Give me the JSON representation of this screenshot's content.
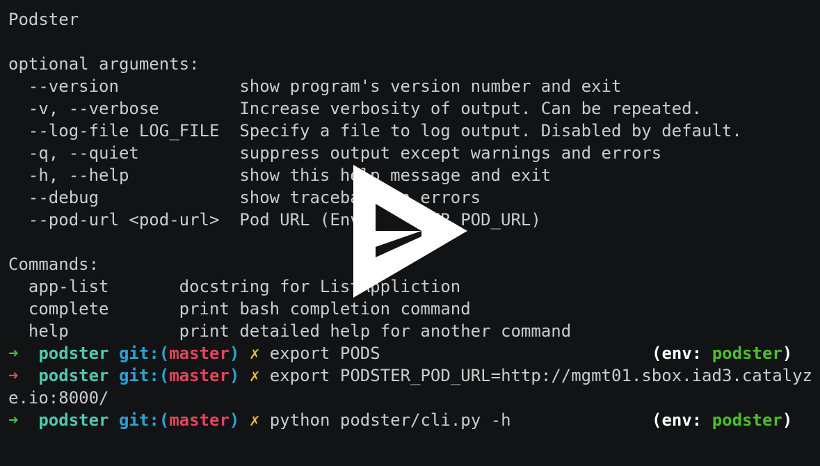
{
  "colors": {
    "background": "#121314",
    "text": "#cccccc",
    "arrow_ok": "#3fbf3f",
    "arrow_err": "#e0475a",
    "dir": "#4fc9b0",
    "git": "#2aa3d6",
    "branch": "#e0475a",
    "dirty": "#e5b93a",
    "env_value": "#4bbf2a",
    "env_label": "#ffffff",
    "play": "#ffffff"
  },
  "help_output": {
    "app_name": "Podster",
    "optional_header": "optional arguments:",
    "options": [
      {
        "flag": "--version",
        "desc": "show program's version number and exit"
      },
      {
        "flag": "-v, --verbose",
        "desc": "Increase verbosity of output. Can be repeated."
      },
      {
        "flag": "--log-file LOG_FILE",
        "desc": "Specify a file to log output. Disabled by default."
      },
      {
        "flag": "-q, --quiet",
        "desc": "suppress output except warnings and errors"
      },
      {
        "flag": "-h, --help",
        "desc": "show this help message and exit"
      },
      {
        "flag": "--debug",
        "desc": "show traceback on errors"
      },
      {
        "flag": "--pod-url <pod-url>",
        "desc": "Pod URL (Env: PODSTER_POD_URL)"
      }
    ],
    "commands_header": "Commands:",
    "commands": [
      {
        "name": "app-list",
        "desc": "docstring for ListAppliction"
      },
      {
        "name": "complete",
        "desc": "print bash completion command"
      },
      {
        "name": "help",
        "desc": "print detailed help for another command"
      }
    ]
  },
  "prompts": [
    {
      "arrow": "➜",
      "status": "ok",
      "dir": "podster",
      "git_label": "git:(",
      "branch": "master",
      "git_close": ")",
      "dirty_mark": "✗",
      "command": "export PODS",
      "continuation": "",
      "env_open": "(env: ",
      "env_name": "podster",
      "env_close": ")"
    },
    {
      "arrow": "➜",
      "status": "err",
      "dir": "podster",
      "git_label": "git:(",
      "branch": "master",
      "git_close": ")",
      "dirty_mark": "✗",
      "command": "export PODSTER_POD_URL=http://mgmt01.sbox.iad3.catalyz",
      "continuation": "e.io:8000/",
      "env_open": "",
      "env_name": "",
      "env_close": ""
    },
    {
      "arrow": "➜",
      "status": "ok",
      "dir": "podster",
      "git_label": "git:(",
      "branch": "master",
      "git_close": ")",
      "dirty_mark": "✗",
      "command": "python podster/cli.py -h",
      "continuation": "",
      "env_open": "(env: ",
      "env_name": "podster",
      "env_close": ")"
    }
  ],
  "player": {
    "icon": "play-icon"
  }
}
